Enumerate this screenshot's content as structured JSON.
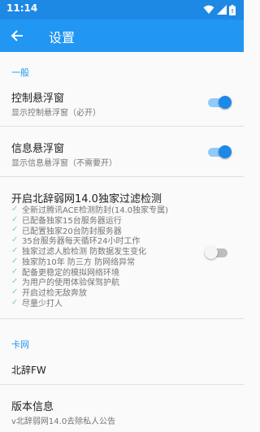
{
  "status_bar": {
    "time": "11:14"
  },
  "toolbar": {
    "title": "设置"
  },
  "sections": {
    "general": "一般",
    "card": "卡网"
  },
  "prefs": {
    "float_control": {
      "title": "控制悬浮窗",
      "summary": "显示控制悬浮窗（必开）",
      "checked": true
    },
    "float_info": {
      "title": "信息悬浮窗",
      "summary": "显示信息悬浮窗（不需要开）",
      "checked": true
    },
    "filter": {
      "title": "开启北辞弱网14.0独家过滤检测",
      "checked": false,
      "features": [
        "全新过腾讯ACE检测防封(14.0独家专属)",
        "已配备独家15台服务器运行",
        "已配置独家20台防封服务器",
        "35台服务器每天循环24小时工作",
        "独家过滤人脸检测 防数据发生变化",
        "独家防10年 防三方 防网络异常",
        "配备更稳定的模拟网络环境",
        "为用户的使用体验保驾护航",
        "开启过检无敌奔放",
        "尽量少打人"
      ]
    },
    "card_value": {
      "title": "北辞FW"
    },
    "version": {
      "title": "版本信息",
      "summary": "v北辞弱网14.0去除私人公告"
    }
  },
  "icons": {
    "back": "arrow-left-icon",
    "wifi": "wifi-icon",
    "signal": "cell-signal-icon",
    "battery": "battery-icon",
    "check": "check-icon"
  },
  "colors": {
    "status_bar": "#1e88e5",
    "app_bar": "#2196f3",
    "accent": "#2196f3",
    "switch_on": "#1e88e5",
    "check": "#80cbc4"
  }
}
